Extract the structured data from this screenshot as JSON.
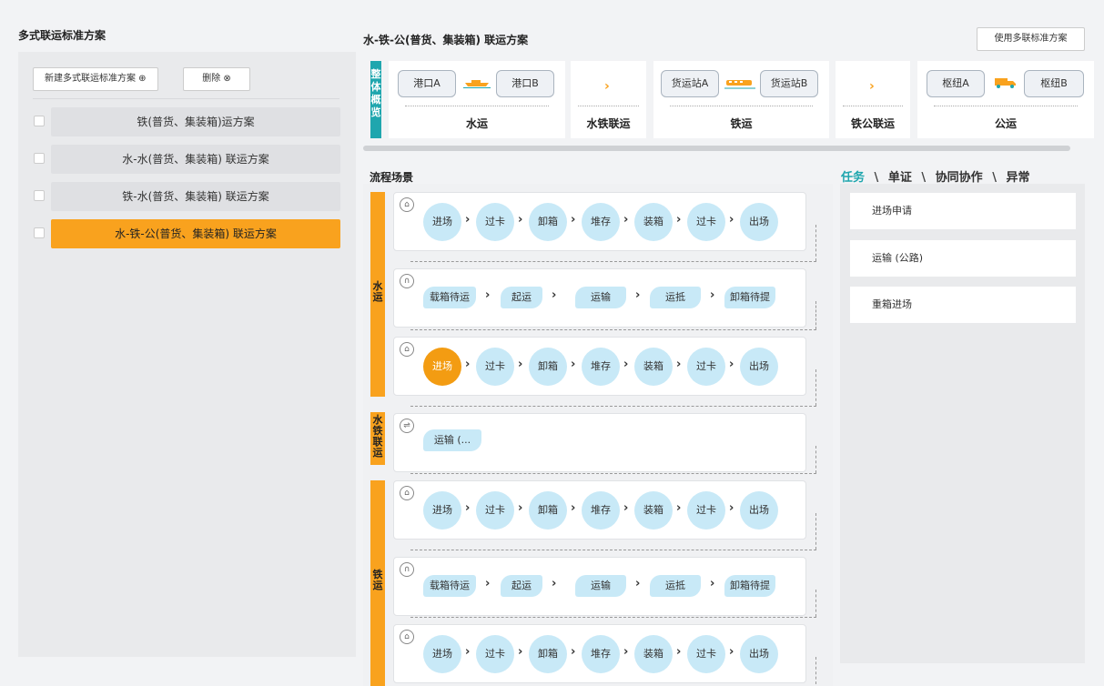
{
  "left": {
    "title": "多式联运标准方案",
    "new_button": "新建多式联运标准方案 ⊕",
    "delete_button": "删除 ⊗",
    "plans": [
      {
        "label": "铁(普货、集装箱)运方案",
        "active": false
      },
      {
        "label": "水-水(普货、集装箱) 联运方案",
        "active": false
      },
      {
        "label": "铁-水(普货、集装箱) 联运方案",
        "active": false
      },
      {
        "label": "水-铁-公(普货、集装箱) 联运方案",
        "active": true
      }
    ]
  },
  "main": {
    "title": "水-铁-公(普货、集装箱) 联运方案",
    "use_button": "使用多联标准方案",
    "overview_label": "整体概览",
    "cards": [
      {
        "name": "水运",
        "from": "港口A",
        "to": "港口B",
        "icon": "ship-icon"
      },
      {
        "name": "水铁联运"
      },
      {
        "name": "铁运",
        "from": "货运站A",
        "to": "货运站B",
        "icon": "train-icon"
      },
      {
        "name": "铁公联运"
      },
      {
        "name": "公运",
        "from": "枢纽A",
        "to": "枢纽B",
        "icon": "truck-icon"
      }
    ]
  },
  "flow": {
    "title": "流程场景",
    "groups": [
      {
        "label": "水运"
      },
      {
        "label": "水铁联运"
      },
      {
        "label": "铁运"
      }
    ],
    "yard_steps": [
      "进场",
      "过卡",
      "卸箱",
      "堆存",
      "装箱",
      "过卡",
      "出场"
    ],
    "transport_steps": [
      "载箱待运",
      "起运",
      "运输",
      "运抵",
      "卸箱待提"
    ],
    "transfer_steps": [
      "运输 (..."
    ]
  },
  "tabs": {
    "active": "任务",
    "items": [
      "单证",
      "协同协作",
      "异常"
    ],
    "sep": "\\"
  },
  "tasks": [
    "进场申请",
    "运输 (公路)",
    "重箱进场"
  ],
  "colors": {
    "accent": "#f9a21e",
    "teal": "#1fa6ae",
    "step": "#c8e9f7"
  }
}
